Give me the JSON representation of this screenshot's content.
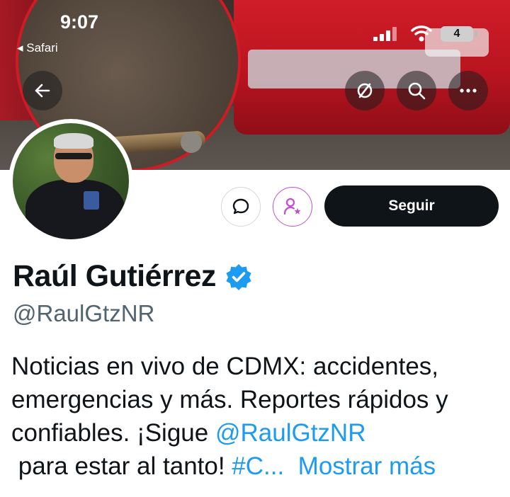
{
  "status_bar": {
    "time": "9:07",
    "back_app": "◂ Safari",
    "battery": "4"
  },
  "nav": {
    "back_icon": "back-arrow-icon",
    "mute_icon": "notifications-off-icon",
    "search_icon": "search-icon",
    "more_icon": "more-icon"
  },
  "profile": {
    "name": "Raúl Gutiérrez",
    "handle": "@RaulGtzNR",
    "follow_label": "Seguir",
    "bio": {
      "line1": "Noticias en vivo de CDMX: accidentes,",
      "line2": "emergencias y más. Reportes rápidos y",
      "line3": "confiables. ¡Sigue ",
      "mention": "@RaulGtzNR",
      "line4": " para estar al tanto! ",
      "hashtag_fragment": "#C...",
      "show_more": "Mostrar más"
    }
  },
  "colors": {
    "accent": "#1d9bf0",
    "follow_bg": "#0f1419",
    "subscribe_purple": "#c34fd1",
    "handle_gray": "#536471"
  }
}
